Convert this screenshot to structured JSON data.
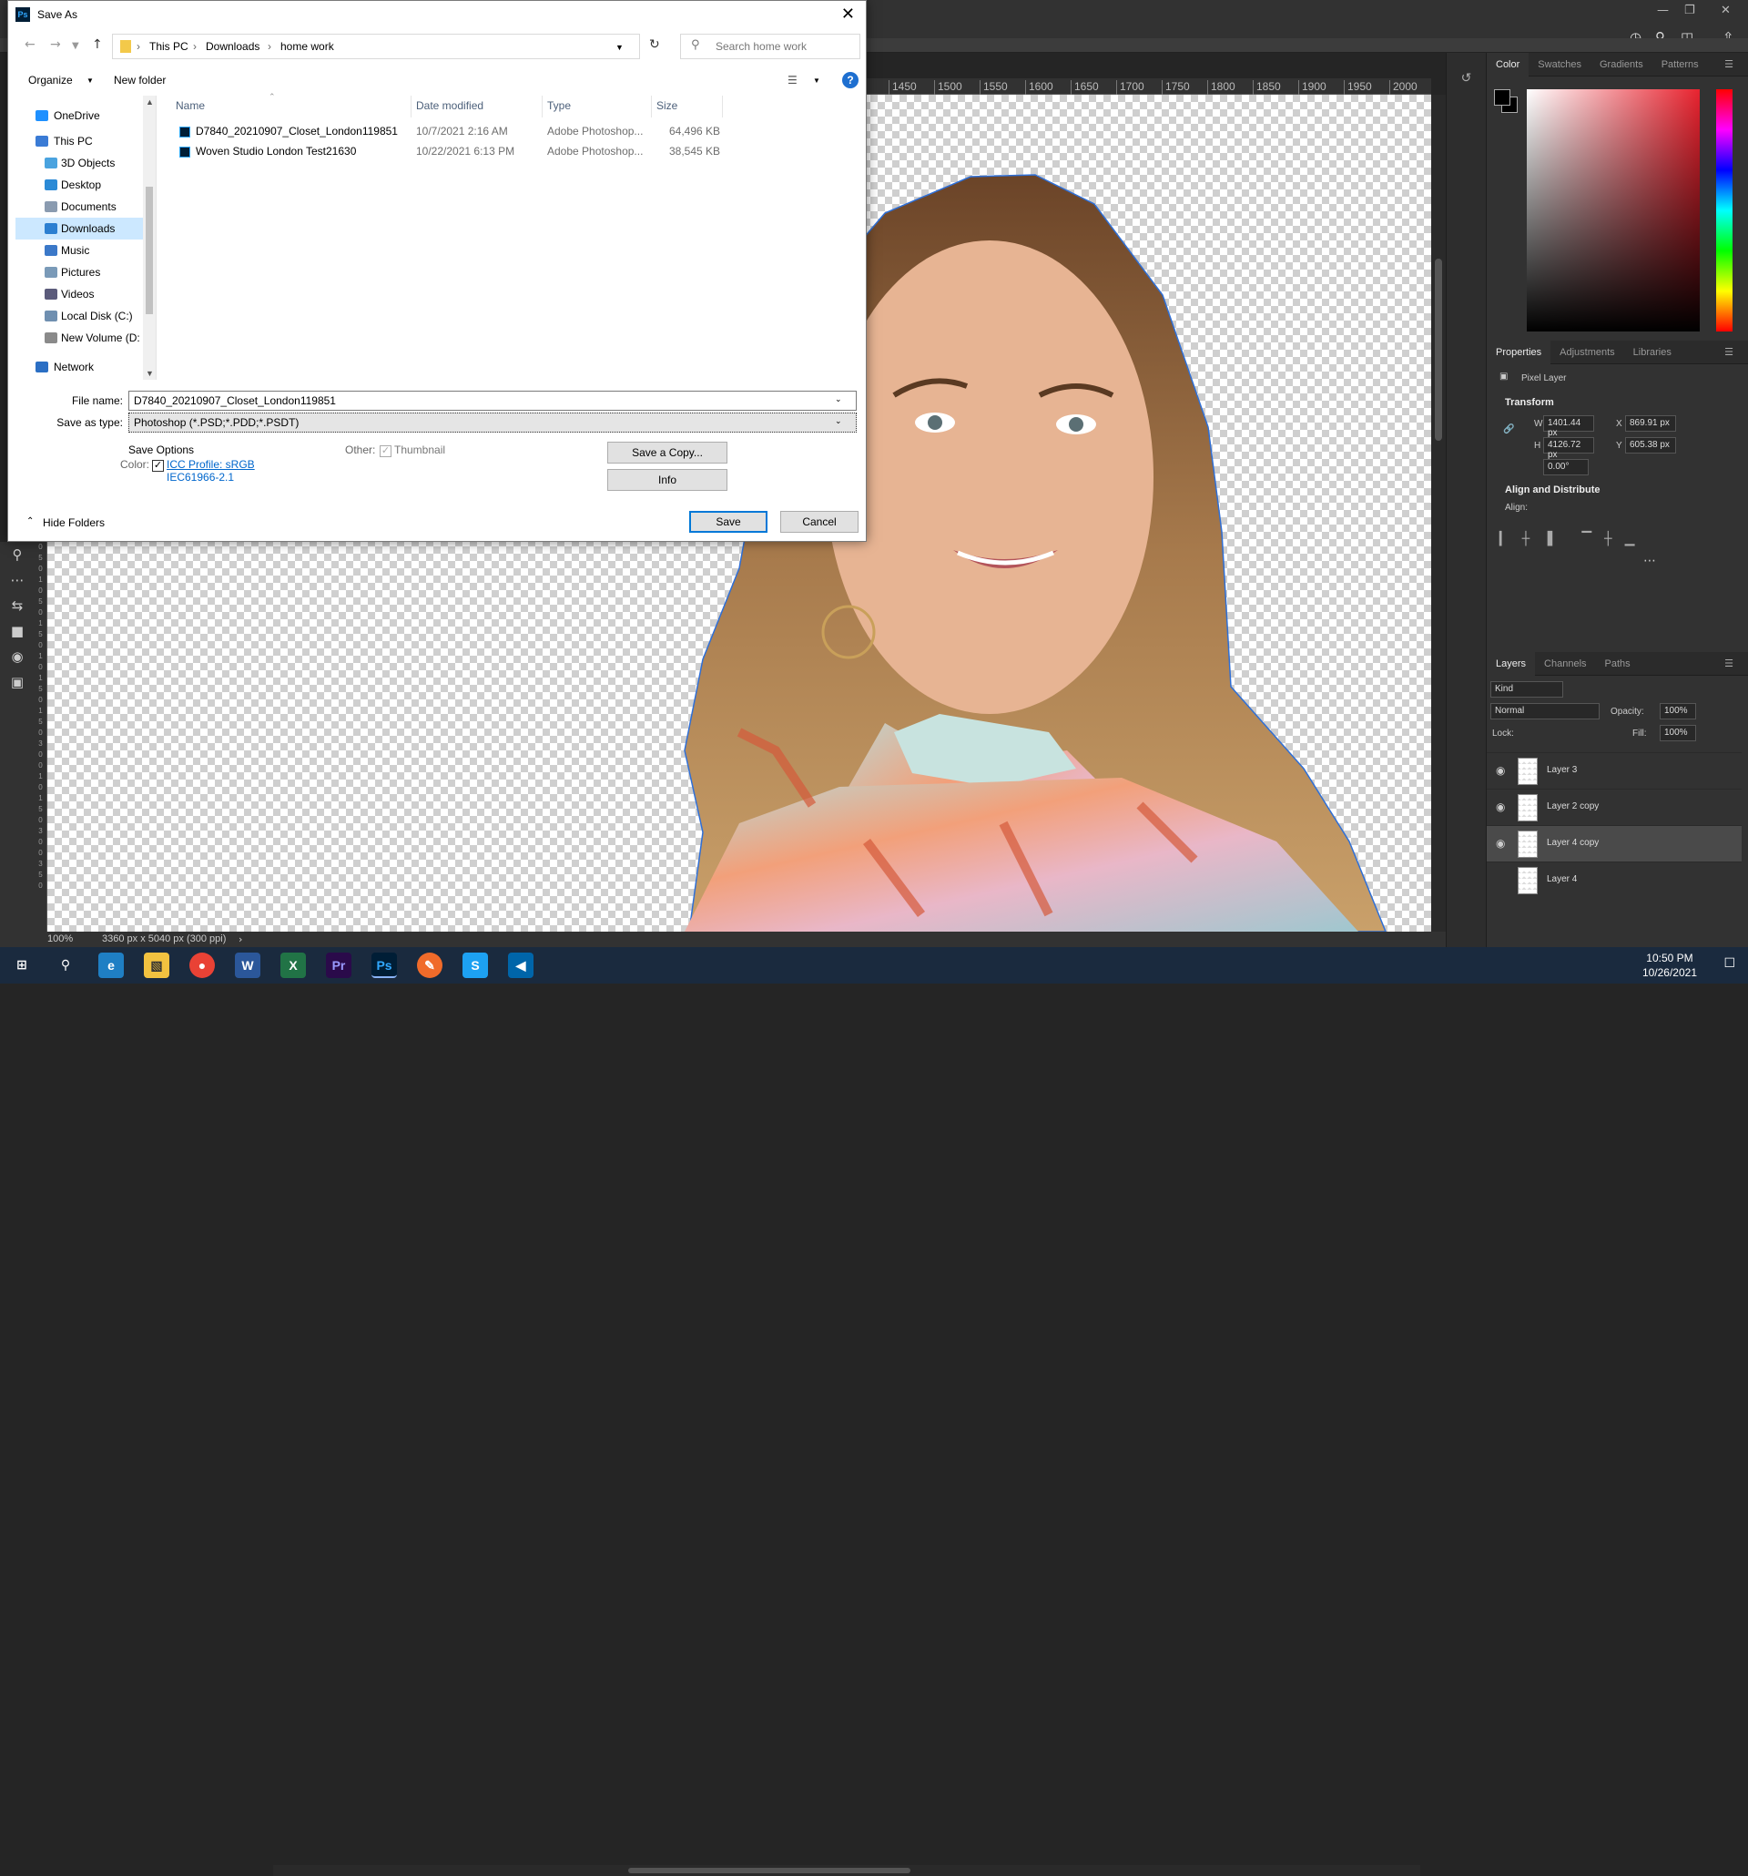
{
  "ps": {
    "status_zoom": "100%",
    "status_doc": "3360 px x 5040 px (300 ppi)",
    "ruler_labels": [
      "1450",
      "1500",
      "1550",
      "1600",
      "1650",
      "1700",
      "1750",
      "1800",
      "1850",
      "1900",
      "1950",
      "2000"
    ],
    "ruler_left_digits": [
      "0",
      "5",
      "0",
      "1",
      "0",
      "5",
      "0",
      "1",
      "5",
      "0",
      "1",
      "0",
      "1",
      "5",
      "0",
      "1",
      "5",
      "0",
      "3",
      "0",
      "0",
      "1",
      "0",
      "1",
      "5",
      "0",
      "3",
      "0",
      "0",
      "3",
      "5",
      "0"
    ],
    "color_tabs": [
      "Color",
      "Swatches",
      "Gradients",
      "Patterns"
    ],
    "properties_tabs": [
      "Properties",
      "Adjustments",
      "Libraries"
    ],
    "pixel_layer": "Pixel Layer",
    "transform_header": "Transform",
    "w_label": "W",
    "w_value": "1401.44 px",
    "h_label": "H",
    "h_value": "4126.72 px",
    "x_label": "X",
    "x_value": "869.91 px",
    "y_label": "Y",
    "y_value": "605.38 px",
    "angle_value": "0.00°",
    "align_header": "Align and Distribute",
    "align_label": "Align:",
    "layers_tabs": [
      "Layers",
      "Channels",
      "Paths"
    ],
    "kind_label": "Kind",
    "blend_mode": "Normal",
    "opacity_label": "Opacity:",
    "opacity_value": "100%",
    "lock_label": "Lock:",
    "fill_label": "Fill:",
    "fill_value": "100%",
    "layers": [
      {
        "name": "Layer 3",
        "visible": true,
        "selected": false
      },
      {
        "name": "Layer 2 copy",
        "visible": true,
        "selected": false
      },
      {
        "name": "Layer 4 copy",
        "visible": true,
        "selected": true
      },
      {
        "name": "Layer 4",
        "visible": false,
        "selected": false
      }
    ]
  },
  "dialog": {
    "title": "Save As",
    "breadcrumb": [
      "This PC",
      "Downloads",
      "home work"
    ],
    "search_placeholder": "Search home work",
    "organize": "Organize",
    "new_folder": "New folder",
    "nav_items": [
      {
        "label": "OneDrive",
        "color": "#1e90ff"
      },
      {
        "label": "This PC",
        "color": "#3a7bd5"
      },
      {
        "label": "3D Objects",
        "color": "#4aa3df"
      },
      {
        "label": "Desktop",
        "color": "#2b8ad6"
      },
      {
        "label": "Documents",
        "color": "#8a9bb0"
      },
      {
        "label": "Downloads",
        "color": "#2c7fd1"
      },
      {
        "label": "Music",
        "color": "#3b78c8"
      },
      {
        "label": "Pictures",
        "color": "#7a9ab8"
      },
      {
        "label": "Videos",
        "color": "#5b5b7b"
      },
      {
        "label": "Local Disk (C:)",
        "color": "#6f8fb0"
      },
      {
        "label": "New Volume (D:",
        "color": "#8a8a8a"
      },
      {
        "label": "Network",
        "color": "#2b6fc4"
      }
    ],
    "columns": [
      "Name",
      "Date modified",
      "Type",
      "Size"
    ],
    "files": [
      {
        "name": "D7840_20210907_Closet_London119851",
        "date": "10/7/2021 2:16 AM",
        "type": "Adobe Photoshop...",
        "size": "64,496 KB"
      },
      {
        "name": "Woven Studio London Test21630",
        "date": "10/22/2021 6:13 PM",
        "type": "Adobe Photoshop...",
        "size": "38,545 KB"
      }
    ],
    "file_name_label": "File name:",
    "file_name_value": "D7840_20210907_Closet_London119851",
    "save_type_label": "Save as type:",
    "save_type_value": "Photoshop (*.PSD;*.PDD;*.PSDT)",
    "save_options": "Save Options",
    "color_label": "Color:",
    "icc_profile": "ICC Profile:  sRGB",
    "icc_profile2": "IEC61966-2.1",
    "other_label": "Other:",
    "thumbnail": "Thumbnail",
    "save_copy": "Save a Copy...",
    "info": "Info",
    "hide_folders": "Hide Folders",
    "save": "Save",
    "cancel": "Cancel"
  },
  "taskbar": {
    "time": "10:50 PM",
    "date": "10/26/2021"
  }
}
